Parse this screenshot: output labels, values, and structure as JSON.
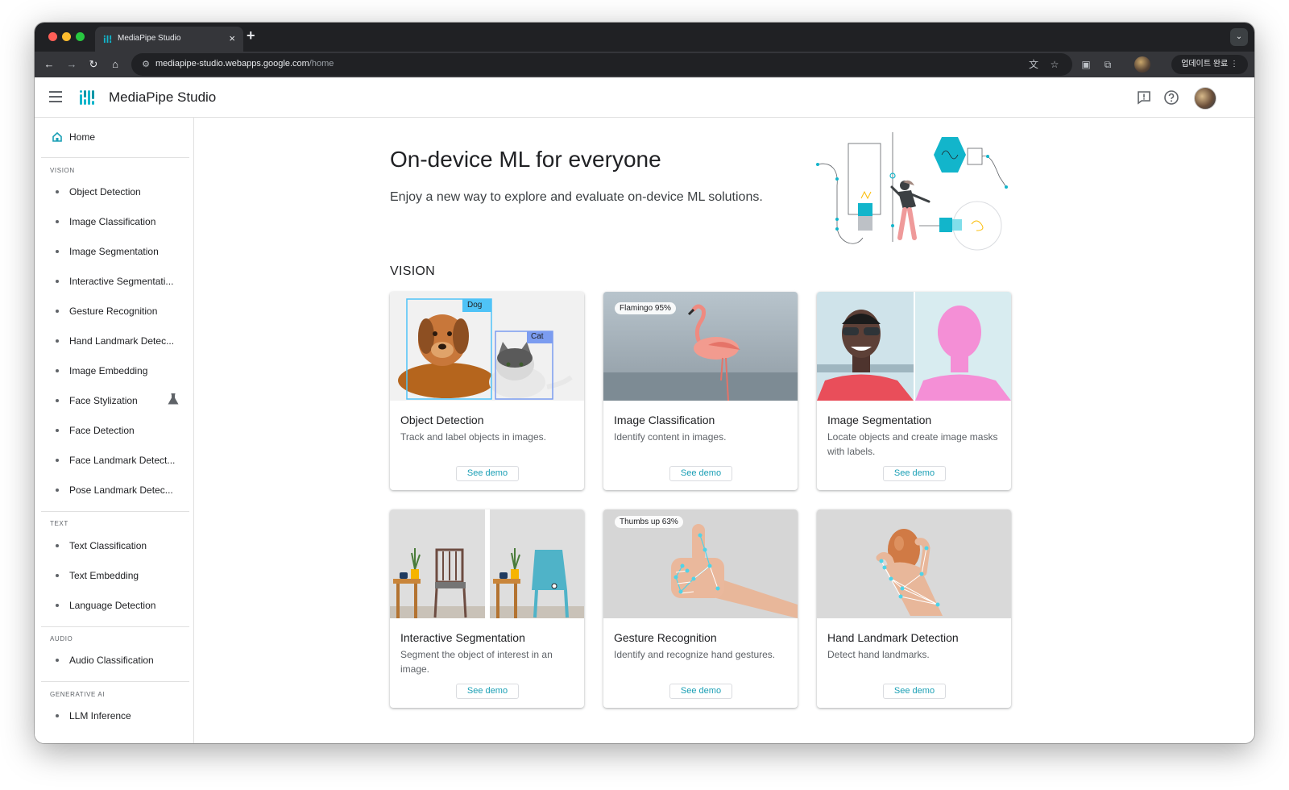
{
  "browser": {
    "tab_title": "MediaPipe Studio",
    "new_tab": "+",
    "url_host": "mediapipe-studio.webapps.google.com",
    "url_path": "/home",
    "update_button": "업데이트 완료",
    "tab_close": "×",
    "tab_search": "⌄"
  },
  "header": {
    "app_title": "MediaPipe Studio"
  },
  "sidebar": {
    "home": "Home",
    "sections": [
      {
        "title": "VISION",
        "items": [
          "Object Detection",
          "Image Classification",
          "Image Segmentation",
          "Interactive Segmentati...",
          "Gesture Recognition",
          "Hand Landmark Detec...",
          "Image Embedding",
          "Face Stylization",
          "Face Detection",
          "Face Landmark Detect...",
          "Pose Landmark Detec..."
        ]
      },
      {
        "title": "TEXT",
        "items": [
          "Text Classification",
          "Text Embedding",
          "Language Detection"
        ]
      },
      {
        "title": "AUDIO",
        "items": [
          "Audio Classification"
        ]
      },
      {
        "title": "GENERATIVE AI",
        "items": [
          "LLM Inference"
        ]
      }
    ]
  },
  "main": {
    "hero_title": "On-device ML for everyone",
    "hero_subtitle": "Enjoy a new way to explore and evaluate on-device ML solutions.",
    "section_title": "VISION",
    "demo_label": "See demo",
    "cards": [
      {
        "title": "Object Detection",
        "desc": "Track and label objects in images.",
        "tags": [
          "Dog",
          "Cat"
        ]
      },
      {
        "title": "Image Classification",
        "desc": "Identify content in images.",
        "tags": [
          "Flamingo 95%"
        ]
      },
      {
        "title": "Image Segmentation",
        "desc": "Locate objects and create image masks with labels.",
        "tags": []
      },
      {
        "title": "Interactive Segmentation",
        "desc": "Segment the object of interest in an image.",
        "tags": []
      },
      {
        "title": "Gesture Recognition",
        "desc": "Identify and recognize hand gestures.",
        "tags": [
          "Thumbs up 63%"
        ]
      },
      {
        "title": "Hand Landmark Detection",
        "desc": "Detect hand landmarks.",
        "tags": []
      }
    ]
  },
  "colors": {
    "accent": "#1a9fb5",
    "logo": "#12b5cb",
    "tab_strip": "#202124",
    "toolbar": "#35363a"
  }
}
